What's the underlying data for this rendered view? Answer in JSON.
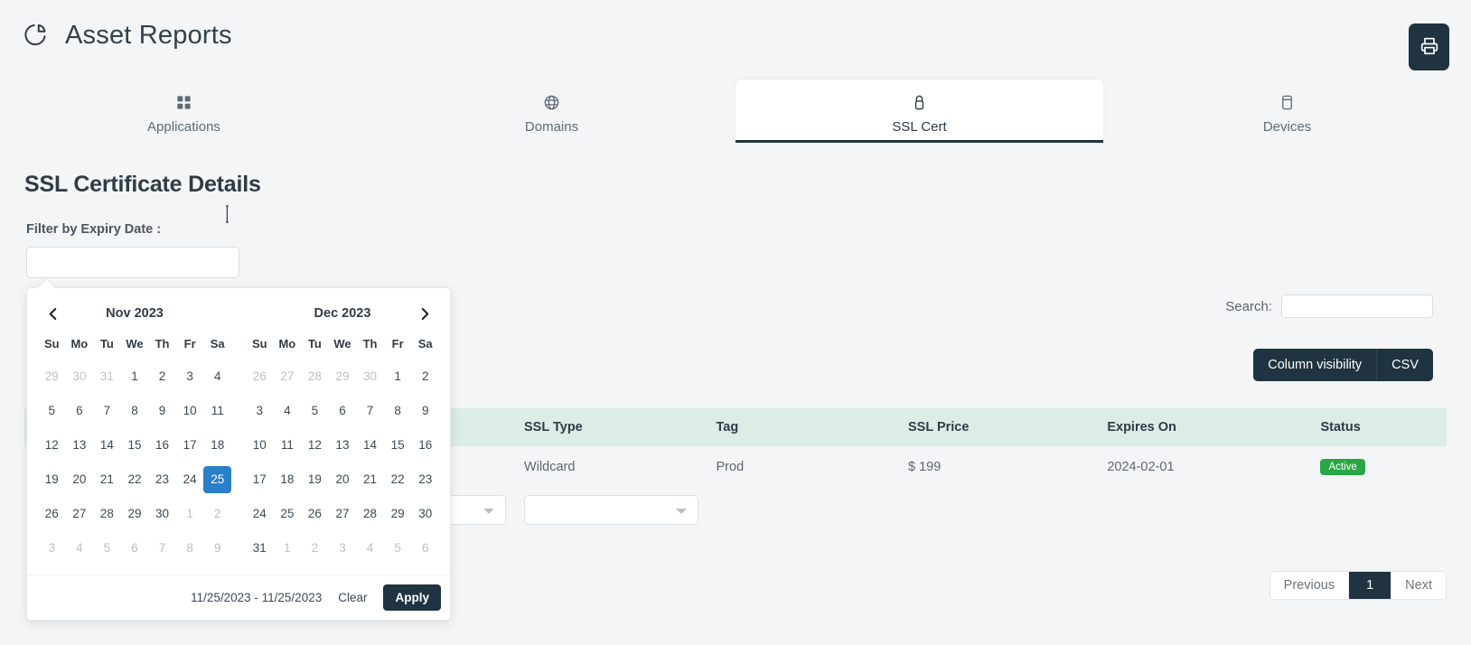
{
  "header": {
    "title": "Asset Reports",
    "logo_icon": "pie-chart-icon",
    "print_button": {
      "icon": "printer-icon",
      "label": "Print"
    }
  },
  "tabs": [
    {
      "label": "Applications",
      "icon": "grid-icon",
      "active": false
    },
    {
      "label": "Domains",
      "icon": "globe-icon",
      "active": false
    },
    {
      "label": "SSL Cert",
      "icon": "lock-icon",
      "active": true
    },
    {
      "label": "Devices",
      "icon": "device-icon",
      "active": false
    }
  ],
  "section": {
    "title": "SSL Certificate Details",
    "filter_label": "Filter by Expiry Date :",
    "filter_value": "",
    "filter_placeholder": ""
  },
  "search": {
    "label": "Search:",
    "value": "",
    "placeholder": ""
  },
  "toolbar": {
    "column_visibility_label": "Column visibility",
    "csv_label": "CSV"
  },
  "table": {
    "columns": [
      "",
      "",
      "SSL Type",
      "Tag",
      "SSL Price",
      "Expires On",
      "Status"
    ],
    "rows": [
      {
        "c0": "",
        "c1": "",
        "ssl_type": "Wildcard",
        "tag": "Prod",
        "ssl_price": "$ 199",
        "expires_on": "2024-02-01",
        "status": "Active"
      }
    ],
    "footer_filters": [
      "",
      "",
      "",
      "",
      "",
      "",
      ""
    ]
  },
  "pagination": {
    "previous": "Previous",
    "pages": [
      "1"
    ],
    "current_page": "1",
    "next": "Next"
  },
  "daterange": {
    "left_month": "Nov 2023",
    "right_month": "Dec 2023",
    "prev_icon": "chevron-left-icon",
    "next_icon": "chevron-right-icon",
    "dow": [
      "Su",
      "Mo",
      "Tu",
      "We",
      "Th",
      "Fr",
      "Sa"
    ],
    "left_days": [
      {
        "d": "29",
        "off": true
      },
      {
        "d": "30",
        "off": true
      },
      {
        "d": "31",
        "off": true
      },
      {
        "d": "1"
      },
      {
        "d": "2"
      },
      {
        "d": "3"
      },
      {
        "d": "4"
      },
      {
        "d": "5"
      },
      {
        "d": "6"
      },
      {
        "d": "7"
      },
      {
        "d": "8"
      },
      {
        "d": "9"
      },
      {
        "d": "10"
      },
      {
        "d": "11"
      },
      {
        "d": "12"
      },
      {
        "d": "13"
      },
      {
        "d": "14"
      },
      {
        "d": "15"
      },
      {
        "d": "16"
      },
      {
        "d": "17"
      },
      {
        "d": "18"
      },
      {
        "d": "19"
      },
      {
        "d": "20"
      },
      {
        "d": "21"
      },
      {
        "d": "22"
      },
      {
        "d": "23"
      },
      {
        "d": "24"
      },
      {
        "d": "25",
        "selected": true
      },
      {
        "d": "26"
      },
      {
        "d": "27"
      },
      {
        "d": "28"
      },
      {
        "d": "29"
      },
      {
        "d": "30"
      },
      {
        "d": "1",
        "off": true
      },
      {
        "d": "2",
        "off": true
      },
      {
        "d": "3",
        "off": true
      },
      {
        "d": "4",
        "off": true
      },
      {
        "d": "5",
        "off": true
      },
      {
        "d": "6",
        "off": true
      },
      {
        "d": "7",
        "off": true
      },
      {
        "d": "8",
        "off": true
      },
      {
        "d": "9",
        "off": true
      }
    ],
    "right_days": [
      {
        "d": "26",
        "off": true
      },
      {
        "d": "27",
        "off": true
      },
      {
        "d": "28",
        "off": true
      },
      {
        "d": "29",
        "off": true
      },
      {
        "d": "30",
        "off": true
      },
      {
        "d": "1"
      },
      {
        "d": "2"
      },
      {
        "d": "3"
      },
      {
        "d": "4"
      },
      {
        "d": "5"
      },
      {
        "d": "6"
      },
      {
        "d": "7"
      },
      {
        "d": "8"
      },
      {
        "d": "9"
      },
      {
        "d": "10"
      },
      {
        "d": "11"
      },
      {
        "d": "12"
      },
      {
        "d": "13"
      },
      {
        "d": "14"
      },
      {
        "d": "15"
      },
      {
        "d": "16"
      },
      {
        "d": "17"
      },
      {
        "d": "18"
      },
      {
        "d": "19"
      },
      {
        "d": "20"
      },
      {
        "d": "21"
      },
      {
        "d": "22"
      },
      {
        "d": "23"
      },
      {
        "d": "24"
      },
      {
        "d": "25"
      },
      {
        "d": "26"
      },
      {
        "d": "27"
      },
      {
        "d": "28"
      },
      {
        "d": "29"
      },
      {
        "d": "30"
      },
      {
        "d": "31"
      },
      {
        "d": "1",
        "off": true
      },
      {
        "d": "2",
        "off": true
      },
      {
        "d": "3",
        "off": true
      },
      {
        "d": "4",
        "off": true
      },
      {
        "d": "5",
        "off": true
      },
      {
        "d": "6",
        "off": true
      }
    ],
    "range_text": "11/25/2023 - 11/25/2023",
    "clear_label": "Clear",
    "apply_label": "Apply"
  },
  "colors": {
    "page_bg": "#f4f5f7",
    "dark": "#1f3440",
    "table_header": "#dcece7",
    "selected_day": "#2a7fc9",
    "badge_active": "#28a745"
  }
}
